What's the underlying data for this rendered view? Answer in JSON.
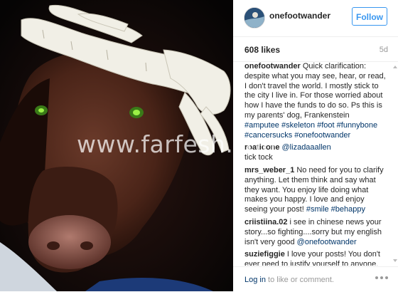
{
  "post": {
    "photo_subject": "dog-with-skeleton-hand-photo",
    "header": {
      "username": "onefootwander",
      "follow_label": "Follow"
    },
    "likes": "608 likes",
    "age": "5d",
    "comments": [
      {
        "user": "onefootwander",
        "text": "Quick clarification: despite what you may see, hear, or read, I don't travel the world. I mostly stick to the city I live in. For those worried about how I have the funds to do so. Ps this is my parents' dog, Frankenstein",
        "tags": "#amputee #skeleton #foot #funnybone #cancersucks #onefootwander"
      },
      {
        "user": "roaticone",
        "text": "@lizadaaallen",
        "tags": "tick tock"
      },
      {
        "user": "mrs_weber_1",
        "text": "No need for you to clarify anything. Let them think and say what they want. You enjoy life doing what makes you happy. I love and enjoy seeing your post!",
        "tags": "#smile #behappy"
      },
      {
        "user": "criistiina.02",
        "text": "i see in chinese news your story...so fighting....sorry but my english isn't very good",
        "tags": "@onefootwander"
      },
      {
        "user": "suziefiggie",
        "text": "I love your posts! You don't ever need to justify yourself to anyone. Sending a hug from the UK x",
        "tags": ""
      }
    ],
    "footer": {
      "login_link": "Log in",
      "login_rest": " to like or comment."
    }
  },
  "watermark": "www.farfesh.com",
  "colors": {
    "accent": "#3897f0",
    "link": "#003569",
    "text": "#262626",
    "muted": "#999999",
    "divider": "#efefef"
  },
  "icons": {
    "more": "three-dots-icon",
    "scroll_up": "scroll-up-arrow-icon",
    "scroll_down": "scroll-down-arrow-icon"
  }
}
